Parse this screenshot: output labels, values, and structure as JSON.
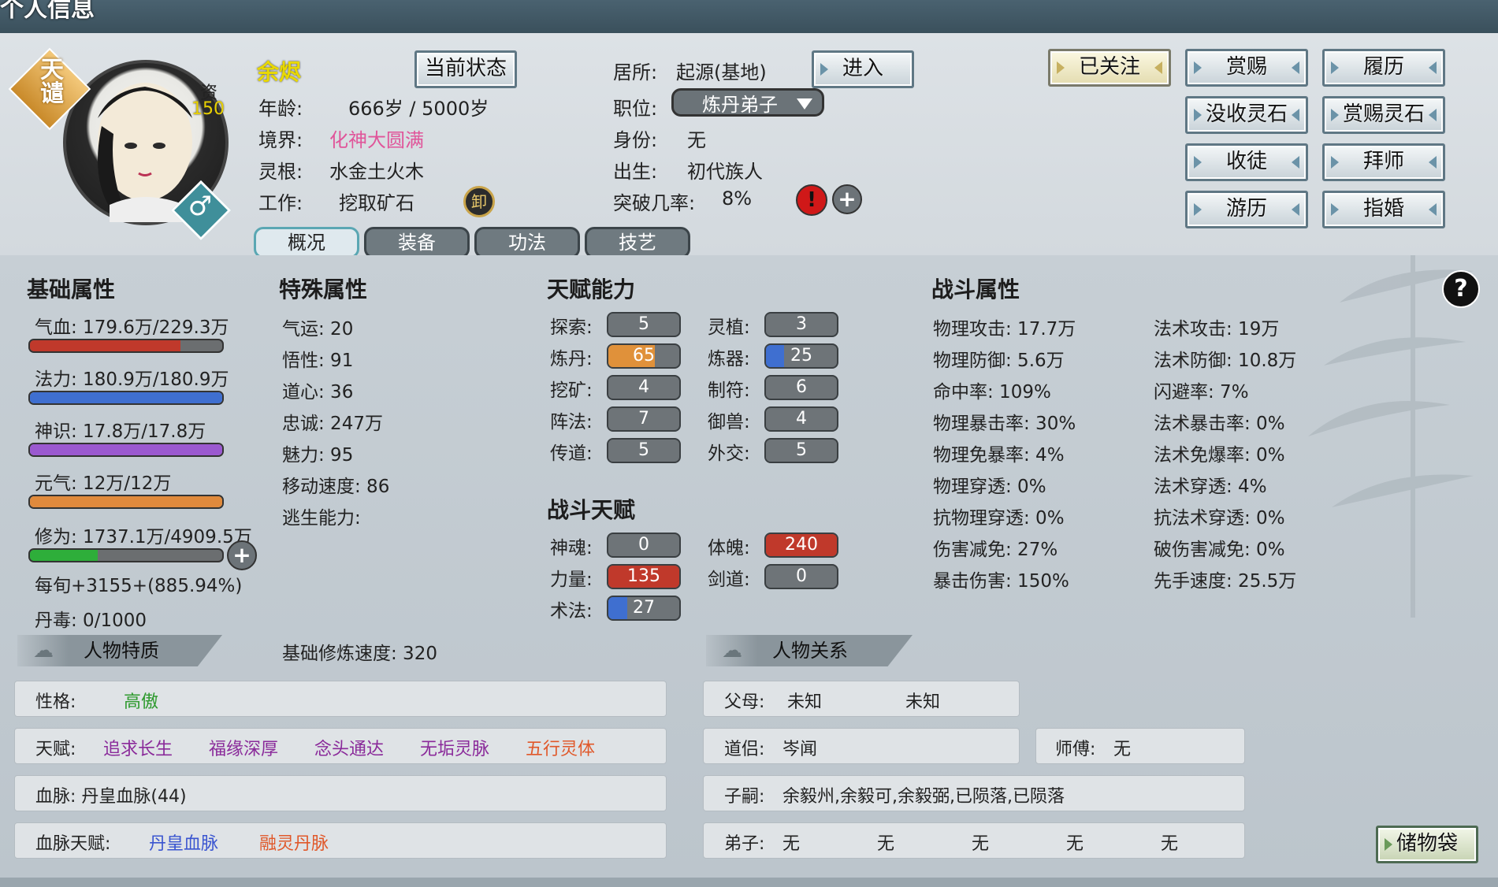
{
  "window": {
    "title": "个人信息"
  },
  "profile": {
    "badge": "天谴",
    "aptitude_label": "资",
    "aptitude_value": "150",
    "gender_icon": "male-icon",
    "name": "余烬",
    "status_button": "当前状态",
    "age_label": "年龄:",
    "age_value": "666岁 / 5000岁",
    "realm_label": "境界:",
    "realm_value": "化神大圆满",
    "root_label": "灵根:",
    "root_value": "水金土火木",
    "work_label": "工作:",
    "work_value": "挖取矿石",
    "work_icon_char": "卸",
    "residence_label": "居所:",
    "residence_value": "起源(基地)",
    "enter_button": "进入",
    "position_label": "职位:",
    "position_value": "炼丹弟子",
    "identity_label": "身份:",
    "identity_value": "无",
    "birth_label": "出生:",
    "birth_value": "初代族人",
    "breakthrough_label": "突破几率:",
    "breakthrough_value": "8%"
  },
  "actions": {
    "followed": "已关注",
    "reward": "赏赐",
    "resume": "履历",
    "confiscate": "没收灵石",
    "reward_stone": "赏赐灵石",
    "take_apprentice": "收徒",
    "become_apprentice": "拜师",
    "travel": "游历",
    "arrange_marriage": "指婚"
  },
  "tabs": [
    "概况",
    "装备",
    "功法",
    "技艺"
  ],
  "basic": {
    "title": "基础属性",
    "hp": {
      "label": "气血: 179.6万/229.3万",
      "ratio": 0.783,
      "color": "#c0392b"
    },
    "mp": {
      "label": "法力: 180.9万/180.9万",
      "ratio": 1.0,
      "color": "#3f6fd0"
    },
    "sense": {
      "label": "神识: 17.8万/17.8万",
      "ratio": 1.0,
      "color": "#9b59d0"
    },
    "vigor": {
      "label": "元气: 12万/12万",
      "ratio": 1.0,
      "color": "#e08a3c"
    },
    "cultivation": {
      "label": "修为: 1737.1万/4909.5万",
      "ratio": 0.354,
      "color": "#2eae3a"
    },
    "per_turn": "每旬+3155+(885.94%)",
    "pill_poison": "丹毒: 0/1000"
  },
  "special": {
    "title": "特殊属性",
    "items": [
      "气运: 20",
      "悟性: 91",
      "道心: 36",
      "忠诚: 247万",
      "魅力: 95",
      "移动速度: 86",
      "逃生能力:"
    ],
    "base_speed": "基础修炼速度: 320"
  },
  "talent": {
    "title": "天赋能力",
    "left": [
      {
        "label": "探索:",
        "value": "5",
        "ratio": 0.05,
        "color": "#6e7478"
      },
      {
        "label": "炼丹:",
        "value": "65",
        "ratio": 0.65,
        "color": "#e0913a"
      },
      {
        "label": "挖矿:",
        "value": "4",
        "ratio": 0.04,
        "color": "#6e7478"
      },
      {
        "label": "阵法:",
        "value": "7",
        "ratio": 0.07,
        "color": "#6e7478"
      },
      {
        "label": "传道:",
        "value": "5",
        "ratio": 0.05,
        "color": "#6e7478"
      }
    ],
    "right": [
      {
        "label": "灵植:",
        "value": "3",
        "ratio": 0.03,
        "color": "#6e7478"
      },
      {
        "label": "炼器:",
        "value": "25",
        "ratio": 0.25,
        "color": "#3f6fd0"
      },
      {
        "label": "制符:",
        "value": "6",
        "ratio": 0.06,
        "color": "#6e7478"
      },
      {
        "label": "御兽:",
        "value": "4",
        "ratio": 0.04,
        "color": "#6e7478"
      },
      {
        "label": "外交:",
        "value": "5",
        "ratio": 0.05,
        "color": "#6e7478"
      }
    ]
  },
  "battle_talent": {
    "title": "战斗天赋",
    "left": [
      {
        "label": "神魂:",
        "value": "0",
        "ratio": 0,
        "color": "#6e7478"
      },
      {
        "label": "力量:",
        "value": "135",
        "ratio": 1.0,
        "color": "#c0392b"
      },
      {
        "label": "术法:",
        "value": "27",
        "ratio": 0.27,
        "color": "#3f6fd0"
      }
    ],
    "right": [
      {
        "label": "体魄:",
        "value": "240",
        "ratio": 1.0,
        "color": "#c0392b"
      },
      {
        "label": "剑道:",
        "value": "0",
        "ratio": 0,
        "color": "#6e7478"
      }
    ]
  },
  "combat": {
    "title": "战斗属性",
    "left": [
      "物理攻击: 17.7万",
      "物理防御: 5.6万",
      "命中率: 109%",
      "物理暴击率: 30%",
      "物理免暴率: 4%",
      "物理穿透: 0%",
      "抗物理穿透: 0%",
      "伤害减免: 27%",
      "暴击伤害: 150%"
    ],
    "right": [
      "法术攻击: 19万",
      "法术防御: 10.8万",
      "闪避率: 7%",
      "法术暴击率: 0%",
      "法术免爆率: 0%",
      "法术穿透: 4%",
      "抗法术穿透: 0%",
      "破伤害减免: 0%",
      "先手速度: 25.5万"
    ]
  },
  "traits": {
    "header": "人物特质",
    "personality_label": "性格:",
    "personality_value": "高傲",
    "talent_label": "天赋:",
    "talents": [
      {
        "text": "追求长生",
        "color": "#8a2a9a"
      },
      {
        "text": "福缘深厚",
        "color": "#8a2a9a"
      },
      {
        "text": "念头通达",
        "color": "#8a2a9a"
      },
      {
        "text": "无垢灵脉",
        "color": "#8a2a9a"
      },
      {
        "text": "五行灵体",
        "color": "#e0582a"
      }
    ],
    "bloodline": "血脉: 丹皇血脉(44)",
    "bloodline_talent_label": "血脉天赋:",
    "bloodline_talents": [
      {
        "text": "丹皇血脉",
        "color": "#3a55d0"
      },
      {
        "text": "融灵丹脉",
        "color": "#e0582a"
      }
    ]
  },
  "relations": {
    "header": "人物关系",
    "parents_label": "父母:",
    "parent1": "未知",
    "parent2": "未知",
    "partner_label": "道侣:",
    "partner_value": "岑闻",
    "master_label": "师傅:",
    "master_value": "无",
    "children_label": "子嗣:",
    "children_value": "余毅州,余毅可,余毅弼,已陨落,已陨落",
    "disciples_label": "弟子:",
    "disciples": [
      "无",
      "无",
      "无",
      "无",
      "无"
    ]
  },
  "storage_button": "储物袋",
  "help_symbol": "?",
  "colors": {
    "realm": "#e0559a",
    "personality": "#2e9a2e",
    "name": "#e8d800"
  }
}
